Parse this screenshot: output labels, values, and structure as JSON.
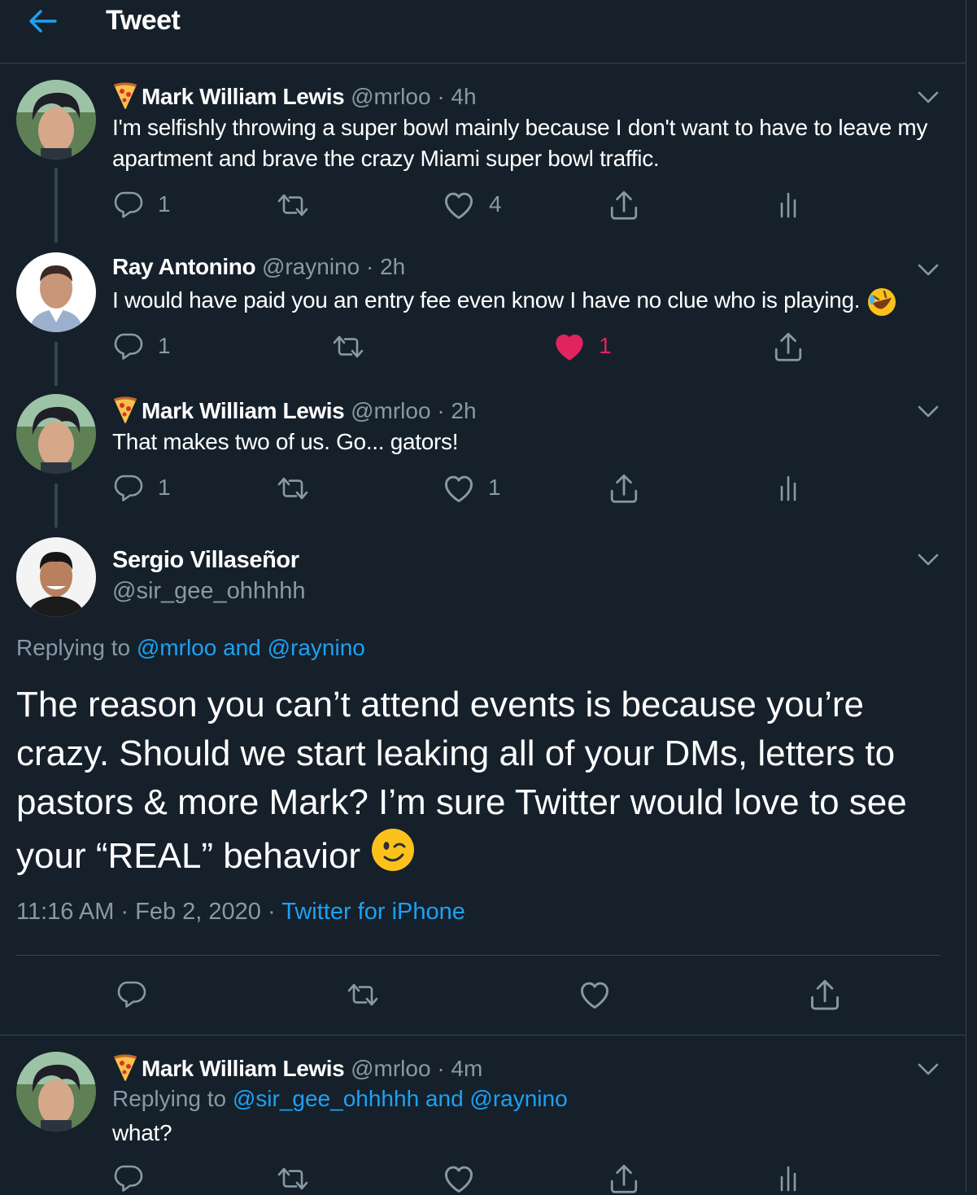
{
  "header": {
    "title": "Tweet"
  },
  "thread": [
    {
      "name": "Mark William Lewis",
      "handle": "@mrloo",
      "dot": "·",
      "time": "4h",
      "text": "I'm selfishly throwing a super bowl mainly because I don't want to have to leave my apartment and brave the crazy Miami super bowl traffic.",
      "replies": "1",
      "retweets": "",
      "likes": "4",
      "liked": false
    },
    {
      "name": "Ray Antonino",
      "handle": "@raynino",
      "dot": "·",
      "time": "2h",
      "text": "I would have paid you an entry fee even know I have no clue who is playing.",
      "replies": "1",
      "retweets": "",
      "likes": "1",
      "liked": true
    },
    {
      "name": "Mark William Lewis",
      "handle": "@mrloo",
      "dot": "·",
      "time": "2h",
      "text": "That makes two of us. Go... gators!",
      "replies": "1",
      "retweets": "",
      "likes": "1",
      "liked": false
    }
  ],
  "main": {
    "name": "Sergio Villaseñor",
    "handle": "@sir_gee_ohhhhh",
    "replying_prefix": "Replying to",
    "replying_to": "@mrloo and @raynino",
    "text": "The reason you can’t attend events is because you’re crazy. Should we start leaking all of your DMs, letters to pastors & more Mark? I’m sure Twitter would love to see your “REAL” behavior",
    "timestamp": "11:16 AM · Feb 2, 2020",
    "separator": "·",
    "source": "Twitter for iPhone"
  },
  "reply": {
    "name": "Mark William Lewis",
    "handle": "@mrloo",
    "dot": "·",
    "time": "4m",
    "replying_prefix": "Replying to",
    "replying_to": "@sir_gee_ohhhhh and @raynino",
    "text": "what?"
  },
  "icons": {
    "back": "arrow-left-icon",
    "caret": "chevron-down-icon",
    "reply": "reply-icon",
    "retweet": "retweet-icon",
    "like": "heart-icon",
    "share": "share-icon",
    "analytics": "analytics-icon",
    "pizza": "pizza-emoji-icon",
    "rofl": "rolling-on-floor-laughing-emoji-icon",
    "wink": "winking-face-emoji-icon"
  },
  "colors": {
    "background": "#15202b",
    "accent": "#1da1f2",
    "secondary_text": "#8899a6",
    "divider": "#38444d",
    "liked": "#e0245e"
  }
}
